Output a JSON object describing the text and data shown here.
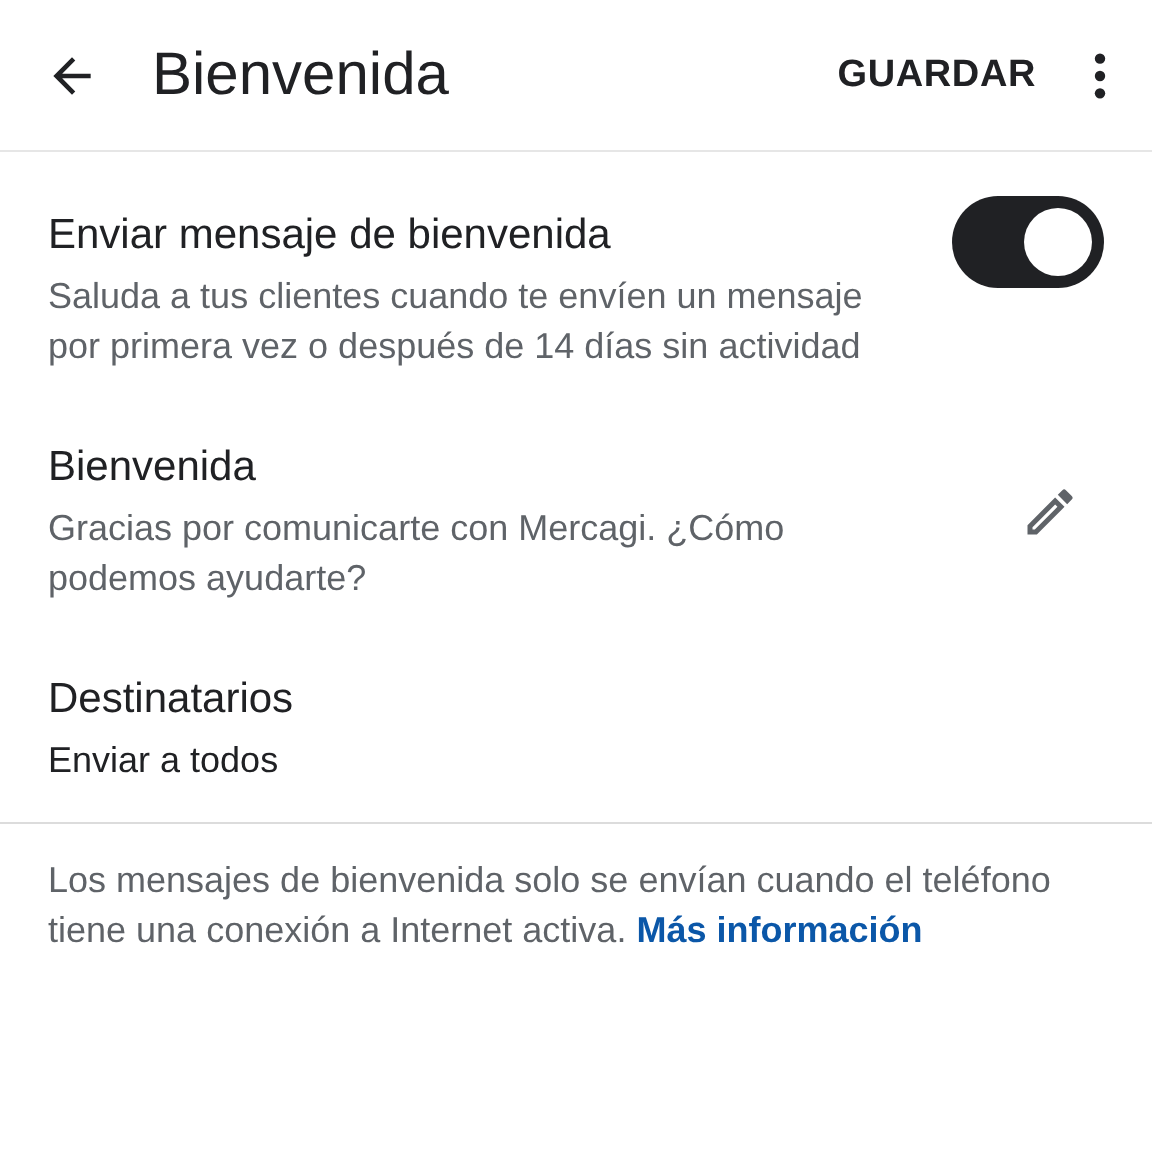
{
  "app_bar": {
    "title": "Bienvenida",
    "action": "GUARDAR"
  },
  "settings": [
    {
      "kind": "toggle",
      "title": "Enviar mensaje de bienvenida",
      "subtitle": "Saluda a tus clientes cuando te envíen un mensaje por primera vez o después de 14 días sin actividad",
      "on": true
    },
    {
      "kind": "edit",
      "title": "Bienvenida",
      "subtitle": "Gracias por comunicarte con Mercagi. ¿Cómo podemos ayudarte?"
    },
    {
      "kind": "plain",
      "title": "Destinatarios",
      "subtitle": "Enviar a todos"
    }
  ],
  "footer": {
    "text": "Los mensajes de bienvenida solo se envían cuando el teléfono tiene una conexión a Internet activa.",
    "link": "Más información"
  }
}
